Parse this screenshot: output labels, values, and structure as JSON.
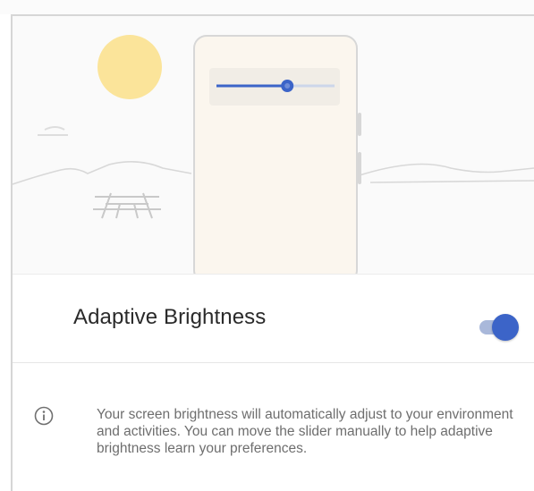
{
  "setting": {
    "title": "Adaptive Brightness",
    "enabled": true
  },
  "info": {
    "icon": "info-icon",
    "description": "Your screen brightness will automatically adjust to your environment and activities. You can move the slider manually to help adaptive brightness learn your preferences."
  },
  "illustration": {
    "brightness_level": 0.6,
    "icons": [
      "sun-icon",
      "phone-icon",
      "brightness-slider-icon",
      "picnic-table-icon",
      "cloud-icon"
    ]
  },
  "colors": {
    "accent": "#3c64c8",
    "toggle_track": "#a9b8da",
    "sun": "#fbe49a",
    "text_primary": "#2a2a2a",
    "text_secondary": "#6e6e6e"
  }
}
